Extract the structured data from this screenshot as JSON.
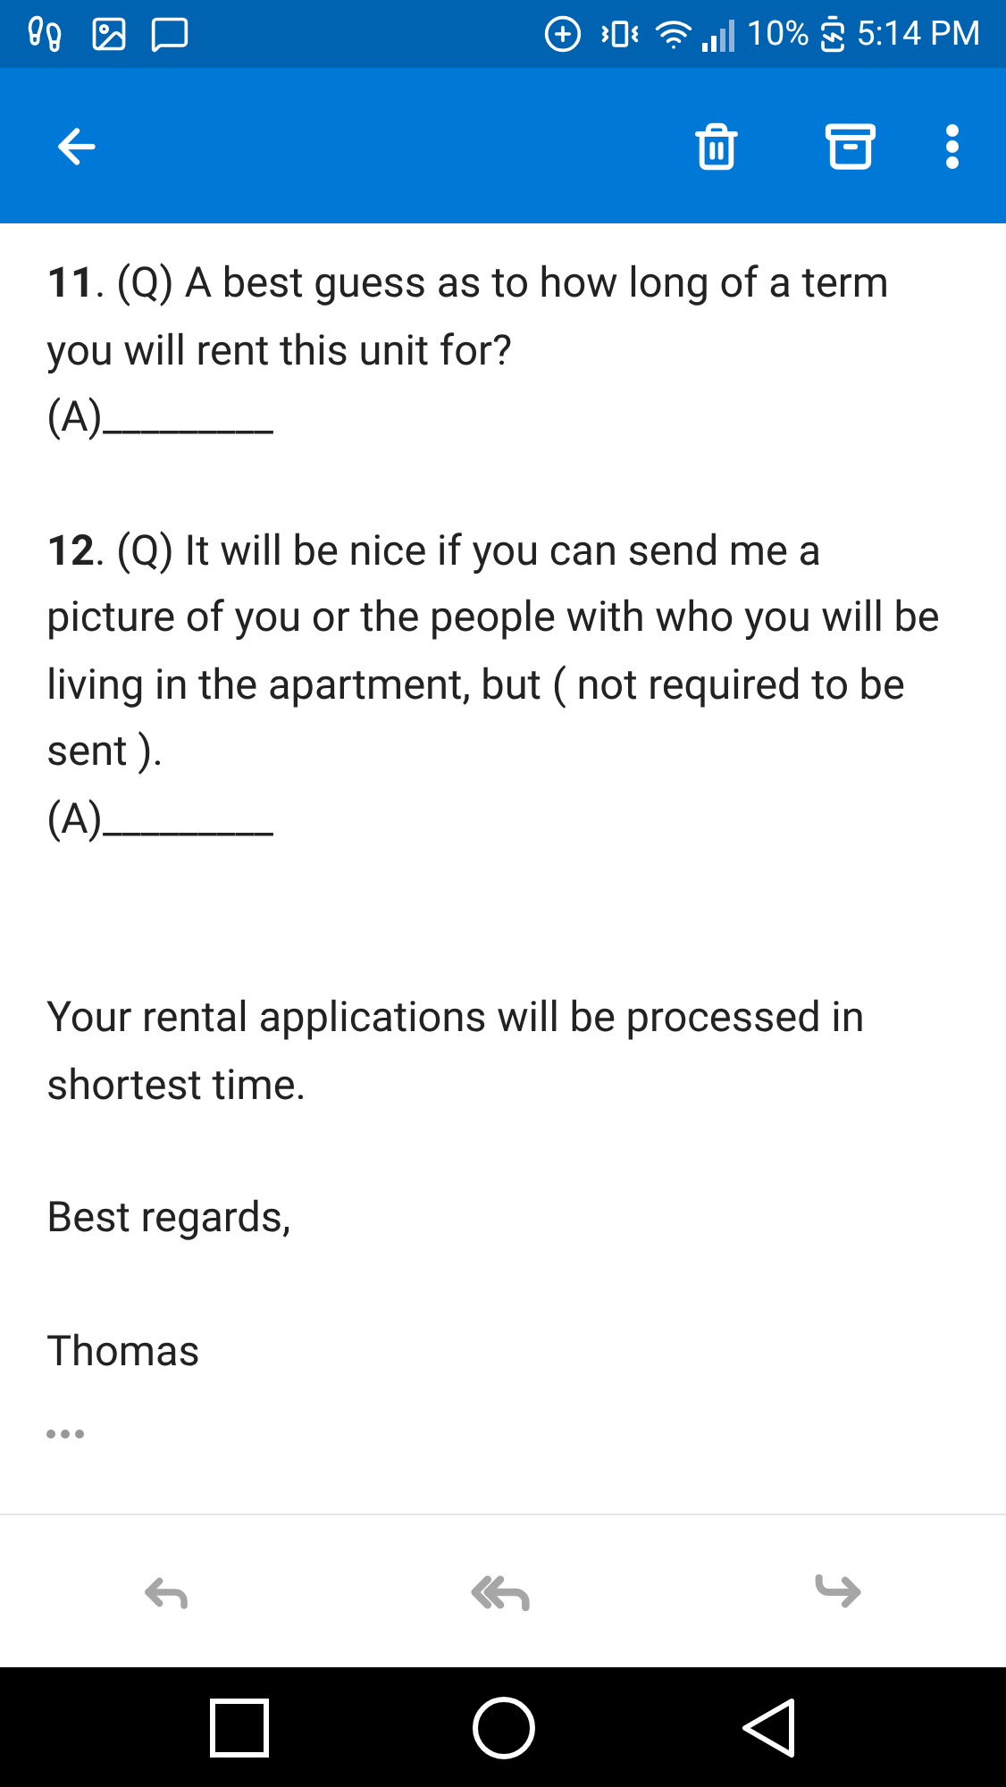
{
  "status_bar": {
    "battery": "10%",
    "time": "5:14 PM"
  },
  "questions": [
    {
      "question": "**11**. (Q) A best guess as to how long of a term you will rent this unit for?",
      "answer": "(A)_________"
    },
    {
      "question": "**12**. (Q) It will be nice if you can send me a picture of you or the people with who you will be living in the apartment, but ( not required to be sent ).",
      "answer": "(A)_________"
    }
  ],
  "body": [
    "Your rental applications will be processed in shortest time.",
    "Best regards,",
    "Thomas"
  ]
}
